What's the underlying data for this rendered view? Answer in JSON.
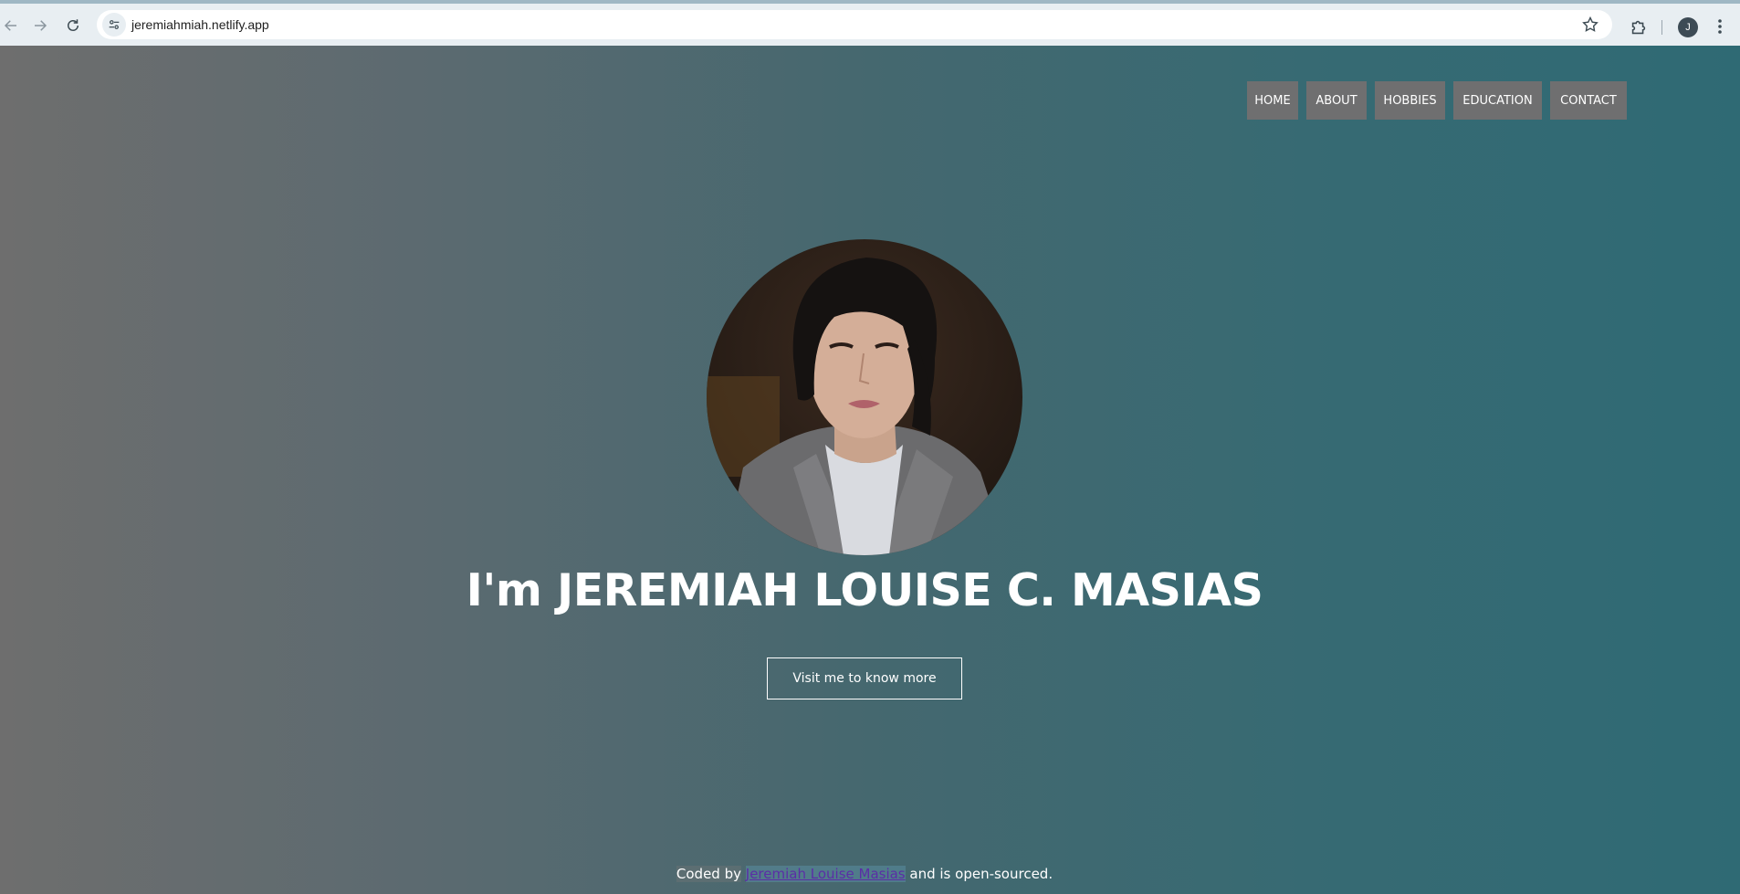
{
  "browser": {
    "url": "jeremiahmiah.netlify.app",
    "profile_initial": "J",
    "icons": {
      "back": "arrow-left-icon",
      "forward": "arrow-right-icon",
      "reload": "reload-icon",
      "site_info": "tune-icon",
      "bookmark": "star-icon",
      "extensions": "puzzle-icon",
      "menu": "vertical-dots-icon"
    }
  },
  "nav": {
    "items": [
      "HOME",
      "ABOUT",
      "HOBBIES",
      "EDUCATION",
      "CONTACT"
    ]
  },
  "hero": {
    "headline": "I'm JEREMIAH LOUISE C. MASIAS",
    "cta_label": "Visit me to know more"
  },
  "footer": {
    "prefix": "Coded by",
    "author_link": "Jeremiah Louise Masias",
    "suffix": "and is open-sourced."
  },
  "colors": {
    "gradient_start": "#6e6e6e",
    "gradient_end": "#2f6a74",
    "nav_bg": "#6f6f70",
    "text": "#ffffff",
    "link": "#5b2ea6"
  }
}
